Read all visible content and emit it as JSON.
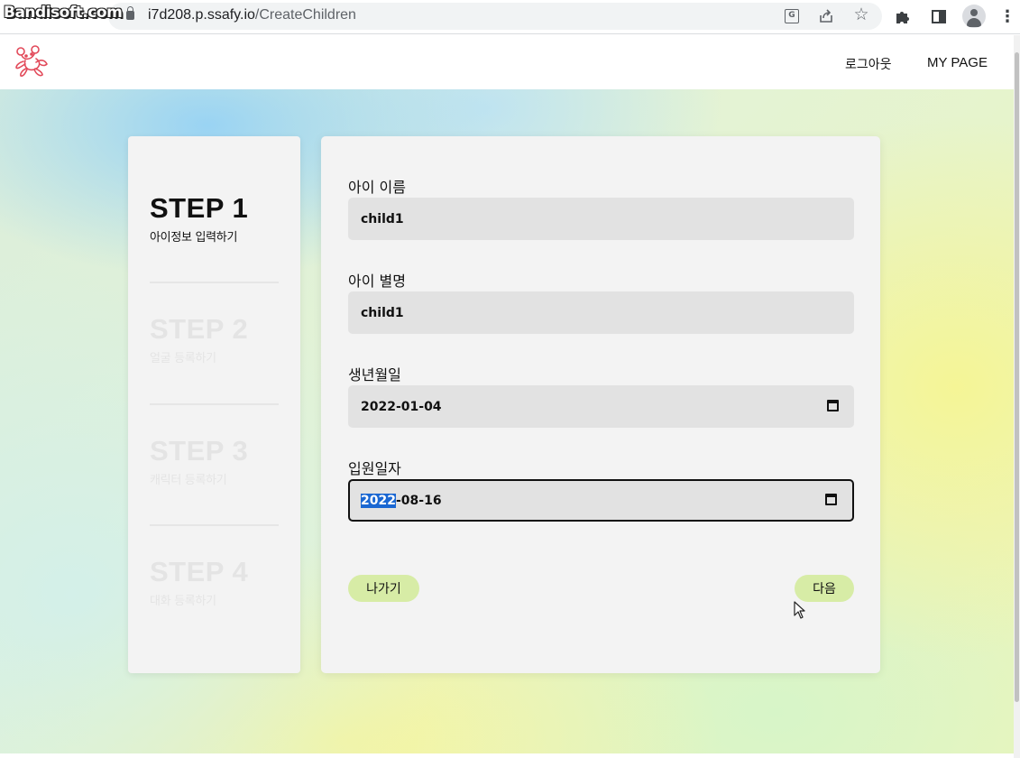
{
  "browser": {
    "watermark": "Bandisoft.com",
    "url_host": "i7d208.p.ssafy.io",
    "url_path": "/CreateChildren",
    "icons": [
      "translate-icon",
      "share-icon",
      "star-icon",
      "puzzle-icon",
      "side-panel-icon",
      "profile-icon",
      "menu-icon"
    ]
  },
  "header": {
    "logo_icon": "teddy-bear-logo-icon",
    "nav": {
      "logout": "로그아웃",
      "mypage": "MY PAGE"
    }
  },
  "steps": [
    {
      "title": "STEP 1",
      "subtitle": "아이정보 입력하기",
      "active": true
    },
    {
      "title": "STEP 2",
      "subtitle": "얼굴 등록하기",
      "active": false
    },
    {
      "title": "STEP 3",
      "subtitle": "캐릭터 등록하기",
      "active": false
    },
    {
      "title": "STEP 4",
      "subtitle": "대화 등록하기",
      "active": false
    }
  ],
  "form": {
    "name": {
      "label": "아이 이름",
      "value": "child1"
    },
    "nickname": {
      "label": "아이 별명",
      "value": "child1"
    },
    "birthdate": {
      "label": "생년월일",
      "value": "2022-01-04"
    },
    "admission": {
      "label": "입원일자",
      "value_selected": "2022",
      "value_rest": "-08-16"
    },
    "buttons": {
      "exit": "나가기",
      "next": "다음"
    }
  },
  "colors": {
    "button_bg": "#d7eca6",
    "panel_bg": "#f3f3f3",
    "input_bg": "#e2e2e2",
    "selection": "#1a67d2"
  }
}
